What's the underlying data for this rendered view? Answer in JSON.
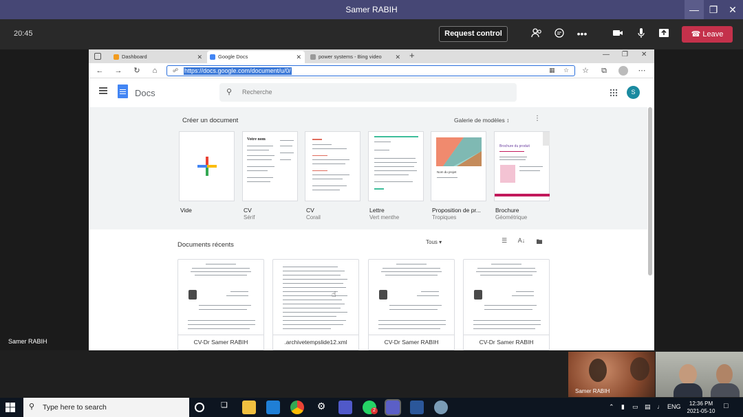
{
  "teams": {
    "window_title": "Samer RABIH",
    "call_time": "20:45",
    "request_control_label": "Request control",
    "leave_label": "Leave",
    "stage_name": "Samer RABIH",
    "participants": [
      {
        "name": "Samer RABIH"
      },
      {
        "name": ""
      }
    ]
  },
  "browser": {
    "tabs": [
      {
        "label": "Dashboard",
        "active": false,
        "icon": "dashboard-icon",
        "icon_color": "#f29c1f"
      },
      {
        "label": "Google Docs",
        "active": true,
        "icon": "docs-icon",
        "icon_color": "#4285f4"
      },
      {
        "label": "power systems - Bing video",
        "active": false,
        "icon": "bing-icon",
        "icon_color": "#999999"
      }
    ],
    "new_tab_label": "+",
    "url": "https://docs.google.com/document/u/0/"
  },
  "docs": {
    "app_title": "Docs",
    "search_placeholder": "Recherche",
    "avatar_letter": "S",
    "avatar_color": "#1a8aa0",
    "create_label": "Créer un document",
    "gallery_label": "Galerie de modèles",
    "templates": [
      {
        "name": "Vide",
        "subtitle": ""
      },
      {
        "name": "CV",
        "subtitle": "Sérif"
      },
      {
        "name": "CV",
        "subtitle": "Corail"
      },
      {
        "name": "Lettre",
        "subtitle": "Vert menthe"
      },
      {
        "name": "Proposition de pr...",
        "subtitle": "Tropiques"
      },
      {
        "name": "Brochure",
        "subtitle": "Géométrique"
      }
    ],
    "recent_label": "Documents récents",
    "owner_filter": "Tous",
    "recent_docs": [
      {
        "name": "CV-Dr Samer RABIH"
      },
      {
        "name": ".archivetempslide12.xml"
      },
      {
        "name": "CV-Dr Samer RABIH"
      },
      {
        "name": "CV-Dr Samer RABIH"
      }
    ]
  },
  "taskbar": {
    "search_placeholder": "Type here to search",
    "language": "ENG",
    "time": "12:36 PM",
    "date": "2021-05-10",
    "whatsapp_badge": "2"
  }
}
